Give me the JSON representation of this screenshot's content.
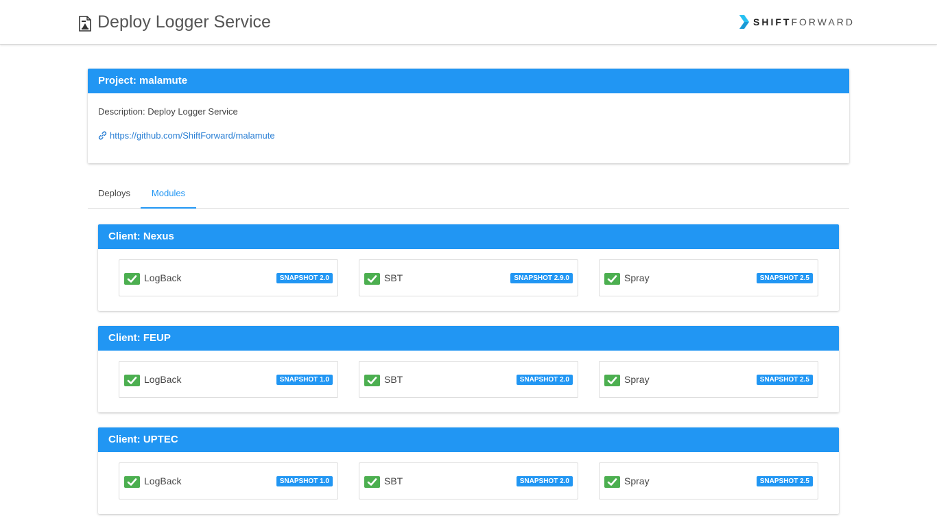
{
  "header": {
    "title": "Deploy Logger Service",
    "doc_icon": "document-icon",
    "logo": {
      "shift": "SHIFT",
      "forward": "FORWARD"
    }
  },
  "project": {
    "title": "Project: malamute",
    "description": "Description: Deploy Logger Service",
    "url": "https://github.com/ShiftForward/malamute",
    "link_icon": "link-icon"
  },
  "tabs": [
    {
      "label": "Deploys",
      "active": false
    },
    {
      "label": "Modules",
      "active": true
    }
  ],
  "clients": [
    {
      "title": "Client: Nexus",
      "modules": [
        {
          "name": "LogBack",
          "version": "SNAPSHOT 2.0"
        },
        {
          "name": "SBT",
          "version": "SNAPSHOT 2.9.0"
        },
        {
          "name": "Spray",
          "version": "SNAPSHOT 2.5"
        }
      ]
    },
    {
      "title": "Client: FEUP",
      "modules": [
        {
          "name": "LogBack",
          "version": "SNAPSHOT 1.0"
        },
        {
          "name": "SBT",
          "version": "SNAPSHOT 2.0"
        },
        {
          "name": "Spray",
          "version": "SNAPSHOT 2.5"
        }
      ]
    },
    {
      "title": "Client: UPTEC",
      "modules": [
        {
          "name": "LogBack",
          "version": "SNAPSHOT 1.0"
        },
        {
          "name": "SBT",
          "version": "SNAPSHOT 2.0"
        },
        {
          "name": "Spray",
          "version": "SNAPSHOT 2.5"
        }
      ]
    }
  ],
  "colors": {
    "primary": "#2196f3",
    "success": "#4caf50",
    "link": "#2a7fd4"
  }
}
